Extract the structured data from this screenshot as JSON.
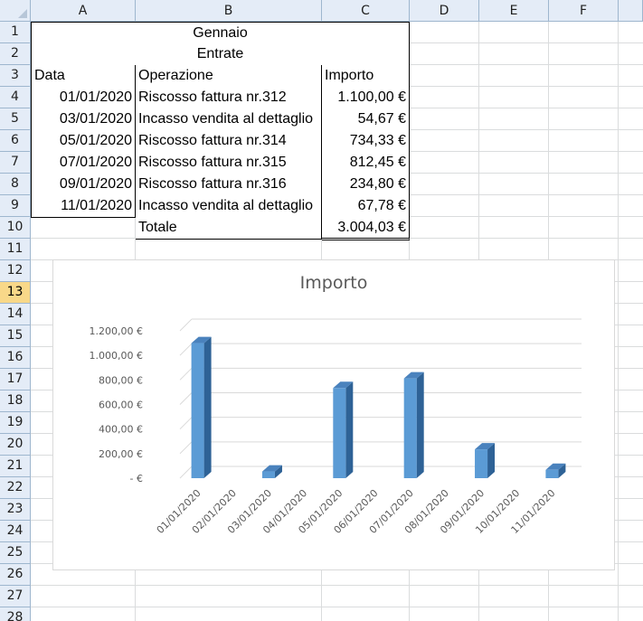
{
  "sheet": {
    "columns": [
      "A",
      "B",
      "C",
      "D",
      "E",
      "F"
    ],
    "rows": [
      "1",
      "2",
      "3",
      "4",
      "5",
      "6",
      "7",
      "8",
      "9",
      "10",
      "11",
      "12",
      "13",
      "14",
      "15",
      "16",
      "17",
      "18",
      "19",
      "20",
      "21",
      "22",
      "23",
      "24",
      "25",
      "26",
      "27",
      "28"
    ],
    "selected_row": "13"
  },
  "table": {
    "title": "Gennaio",
    "subtitle": "Entrate",
    "headers": {
      "date": "Data",
      "operation": "Operazione",
      "amount": "Importo"
    },
    "rows": [
      {
        "date": "01/01/2020",
        "operation": "Riscosso fattura nr.312",
        "amount": "1.100,00 €"
      },
      {
        "date": "03/01/2020",
        "operation": "Incasso vendita al dettaglio",
        "amount": "54,67 €"
      },
      {
        "date": "05/01/2020",
        "operation": "Riscosso fattura nr.314",
        "amount": "734,33 €"
      },
      {
        "date": "07/01/2020",
        "operation": "Riscosso fattura nr.315",
        "amount": "812,45 €"
      },
      {
        "date": "09/01/2020",
        "operation": "Riscosso fattura nr.316",
        "amount": "234,80 €"
      },
      {
        "date": "11/01/2020",
        "operation": "Incasso vendita al dettaglio",
        "amount": "67,78 €"
      }
    ],
    "total_label": "Totale",
    "total_value": "3.004,03 €"
  },
  "colors": {
    "bar_front": "#5b9bd5",
    "bar_side": "#2e6296",
    "bar_top": "#4a82bd",
    "header_bg": "#e4ecf7",
    "selected_row_bg": "#f8d889"
  },
  "chart_data": {
    "type": "bar",
    "title": "Importo",
    "categories": [
      "01/01/2020",
      "02/01/2020",
      "03/01/2020",
      "04/01/2020",
      "05/01/2020",
      "06/01/2020",
      "07/01/2020",
      "08/01/2020",
      "09/01/2020",
      "10/01/2020",
      "11/01/2020"
    ],
    "values": [
      1100,
      0,
      54.67,
      0,
      734.33,
      0,
      812.45,
      0,
      234.8,
      0,
      67.78
    ],
    "ylim": [
      0,
      1200
    ],
    "ytick_values": [
      0,
      200,
      400,
      600,
      800,
      1000,
      1200
    ],
    "ytick_labels": [
      "-  €",
      "200,00 €",
      "400,00 €",
      "600,00 €",
      "800,00 €",
      "1.000,00 €",
      "1.200,00 €"
    ],
    "grid": true,
    "style": "3d-column"
  }
}
